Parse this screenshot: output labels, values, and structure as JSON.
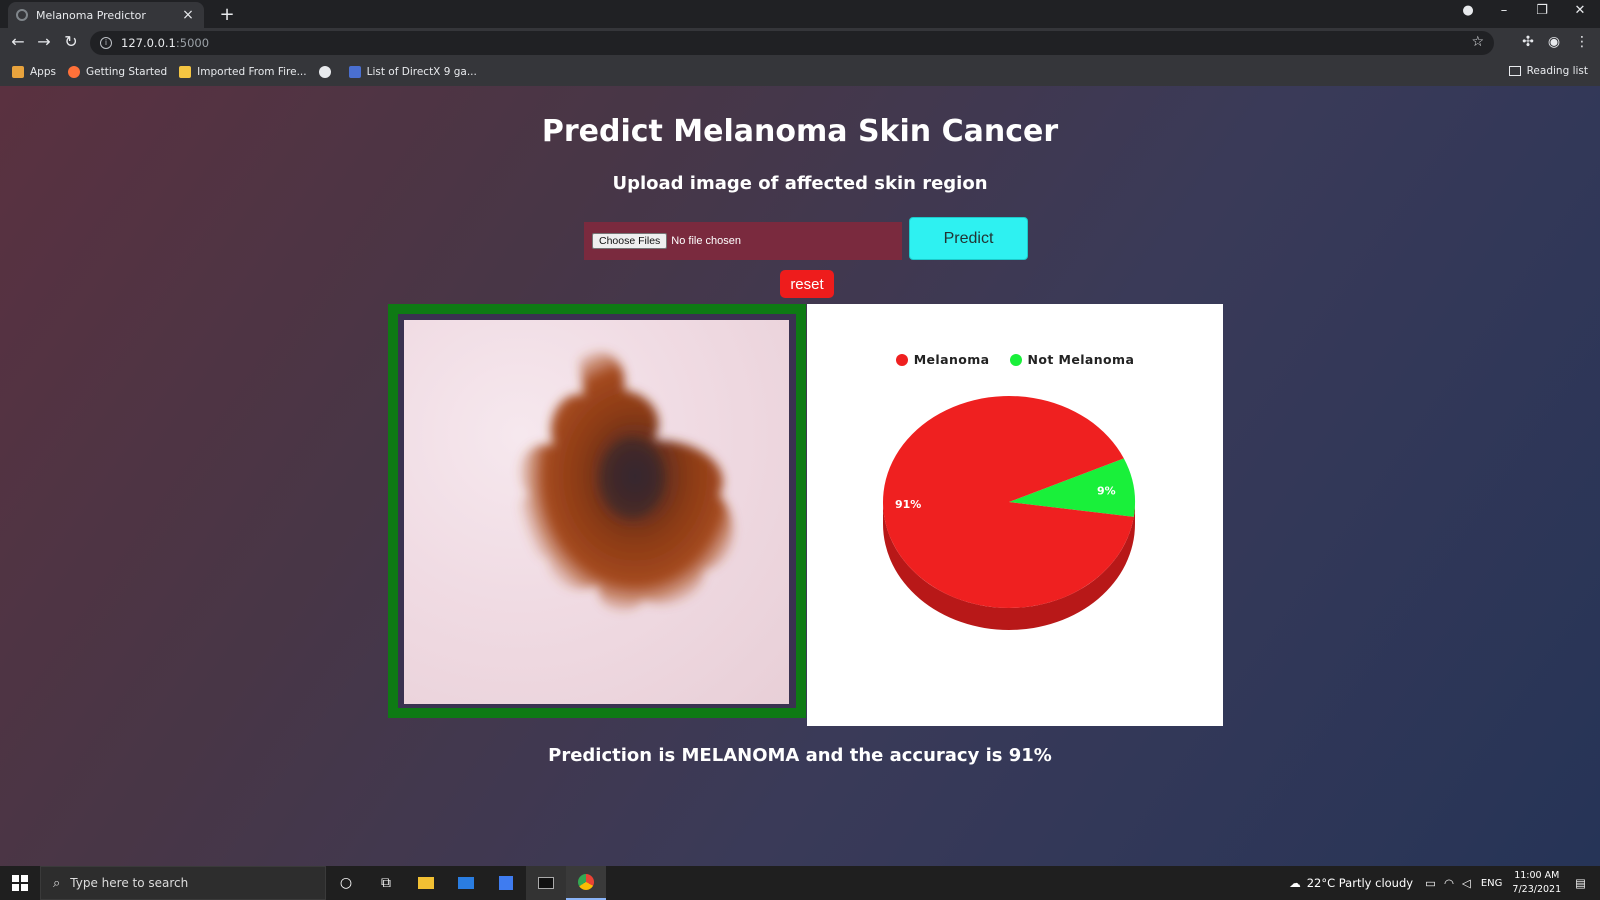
{
  "browser": {
    "tab_title": "Melanoma Predictor",
    "tab_close": "×",
    "new_tab": "+",
    "url_host": "127.0.0.1",
    "url_port": ":5000",
    "bookmarks": [
      {
        "label": "Apps",
        "icon": "apps-grid-icon",
        "color": "#e8a33d"
      },
      {
        "label": "Getting Started",
        "icon": "firefox-icon",
        "color": "#ff7139"
      },
      {
        "label": "Imported From Fire...",
        "icon": "folder-icon",
        "color": "#f5c542"
      },
      {
        "label": "",
        "icon": "globe-icon",
        "color": "#e8eaed"
      },
      {
        "label": "List of DirectX 9 ga...",
        "icon": "wiki-icon",
        "color": "#4a6fd0"
      }
    ],
    "reading_list": "Reading list"
  },
  "page": {
    "title": "Predict Melanoma Skin Cancer",
    "subtitle": "Upload image of affected skin region",
    "choose_files": "Choose Files",
    "no_file": "No file chosen",
    "predict_label": "Predict",
    "reset_label": "reset",
    "result": "Prediction is MELANOMA and the accuracy is 91%",
    "colors": {
      "frame": "#0e7a14",
      "predict": "#2ef1f1",
      "reset": "#ee1c1c"
    }
  },
  "chart_data": {
    "type": "pie",
    "title": "",
    "legend_position": "top",
    "categories": [
      "Melanoma",
      "Not Melanoma"
    ],
    "values": [
      91,
      9
    ],
    "labels": [
      "91%",
      "9%"
    ],
    "colors": [
      "#ef2020",
      "#19f03a"
    ],
    "style": "3d"
  },
  "taskbar": {
    "search_placeholder": "Type here to search",
    "weather": "22°C  Partly cloudy",
    "lang": "ENG",
    "time": "11:00 AM",
    "date": "7/23/2021"
  }
}
